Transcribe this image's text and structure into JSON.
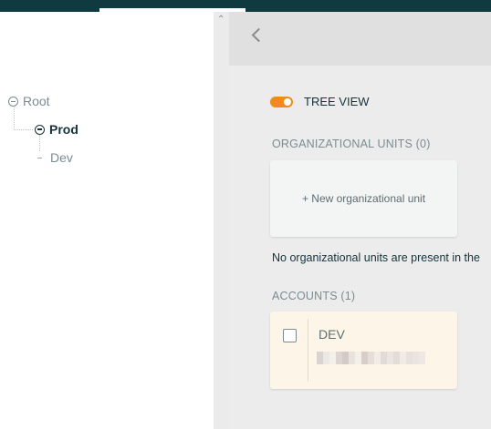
{
  "tree": {
    "root_label": "Root",
    "prod_label": "Prod",
    "dev_label": "Dev"
  },
  "toolbar": {
    "back_icon": "chevron-left-icon"
  },
  "tree_view_toggle": {
    "label": "TREE VIEW",
    "on": true,
    "color": "#f08a1d"
  },
  "org_units": {
    "title": "ORGANIZATIONAL UNITS (0)",
    "new_label": "+ New organizational unit",
    "empty_text": "No organizational units are present in the"
  },
  "accounts": {
    "title": "ACCOUNTS (1)",
    "items": [
      {
        "name": "DEV",
        "checked": false
      }
    ]
  },
  "colors": {
    "header_bar": "#0f3a40",
    "accent_orange": "#f08a1d",
    "account_card_bg": "#fdf6e8"
  }
}
